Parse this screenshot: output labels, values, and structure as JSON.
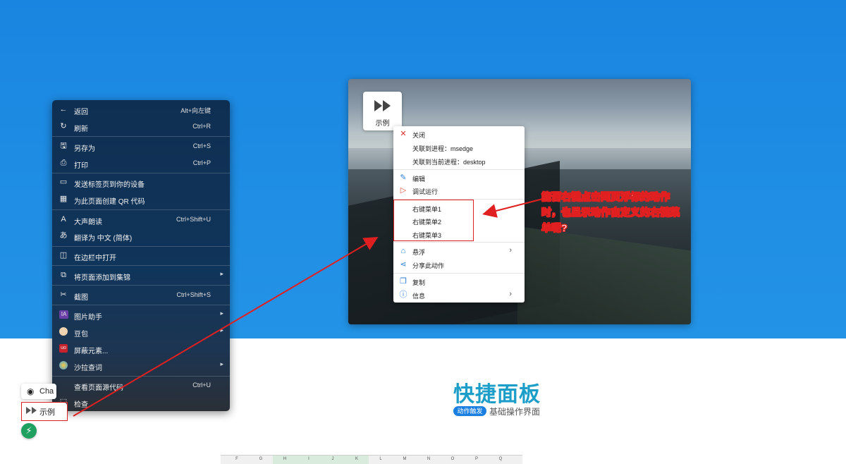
{
  "browser_menu": {
    "items": [
      {
        "label": "返回",
        "shortcut": "Alt+向左键",
        "icon": "back-arrow-icon"
      },
      {
        "label": "刷新",
        "shortcut": "Ctrl+R",
        "icon": "refresh-icon"
      },
      {
        "label": "另存为",
        "shortcut": "Ctrl+S",
        "icon": "save-icon"
      },
      {
        "label": "打印",
        "shortcut": "Ctrl+P",
        "icon": "print-icon"
      },
      {
        "label": "发送标签页到你的设备",
        "shortcut": "",
        "icon": "send-device-icon"
      },
      {
        "label": "为此页面创建 QR 代码",
        "shortcut": "",
        "icon": "qr-code-icon"
      },
      {
        "label": "大声朗读",
        "shortcut": "Ctrl+Shift+U",
        "icon": "read-aloud-icon"
      },
      {
        "label": "翻译为 中文 (简体)",
        "shortcut": "",
        "icon": "translate-icon"
      },
      {
        "label": "在边栏中打开",
        "shortcut": "",
        "icon": "sidebar-icon"
      },
      {
        "label": "将页面添加到集锦",
        "shortcut": "",
        "icon": "collections-icon"
      },
      {
        "label": "截图",
        "shortcut": "Ctrl+Shift+S",
        "icon": "screenshot-icon"
      },
      {
        "label": "图片助手",
        "shortcut": "",
        "icon": "image-assistant-icon"
      },
      {
        "label": "豆包",
        "shortcut": "",
        "icon": "doubao-icon"
      },
      {
        "label": "屏蔽元素...",
        "shortcut": "",
        "icon": "block-element-icon"
      },
      {
        "label": "沙拉查词",
        "shortcut": "",
        "icon": "salad-dict-icon"
      },
      {
        "label": "查看页面源代码",
        "shortcut": "Ctrl+U",
        "icon": "view-source-icon"
      },
      {
        "label": "检查",
        "shortcut": "",
        "icon": "inspect-icon"
      }
    ]
  },
  "demo_button": {
    "label": "示例"
  },
  "action_menu": {
    "items": [
      {
        "label": "关闭",
        "icon": "close-icon"
      },
      {
        "label": "关联到进程：msedge",
        "icon": ""
      },
      {
        "label": "关联到当前进程：desktop",
        "icon": ""
      },
      {
        "label": "编辑",
        "icon": "edit-icon"
      },
      {
        "label": "调试运行",
        "icon": "debug-run-icon"
      },
      {
        "label": "右键菜单1",
        "icon": ""
      },
      {
        "label": "右键菜单2",
        "icon": ""
      },
      {
        "label": "右键菜单3",
        "icon": ""
      },
      {
        "label": "悬浮",
        "icon": "float-icon"
      },
      {
        "label": "分享此动作",
        "icon": "share-icon"
      },
      {
        "label": "复制",
        "icon": "copy-icon"
      },
      {
        "label": "信息",
        "icon": "info-icon"
      }
    ]
  },
  "annotation": {
    "text": "能否右键点击网页浮标的动作时，也显示动作自定义的右键菜单呢?"
  },
  "quick_panel": {
    "title": "快捷面板",
    "badge": "动作触发",
    "subtitle": "基础操作界面"
  },
  "floating": {
    "chat_label": "Cha",
    "demo_label": "示例"
  },
  "sheet_columns": [
    "F",
    "G",
    "H",
    "I",
    "J",
    "K",
    "L",
    "M",
    "N",
    "O",
    "P",
    "Q"
  ],
  "colors": {
    "hero_blue": "#1a85e0",
    "annotation_red": "#e02020",
    "title_teal": "#1d9ec9",
    "badge_blue": "#1a7fe0"
  }
}
